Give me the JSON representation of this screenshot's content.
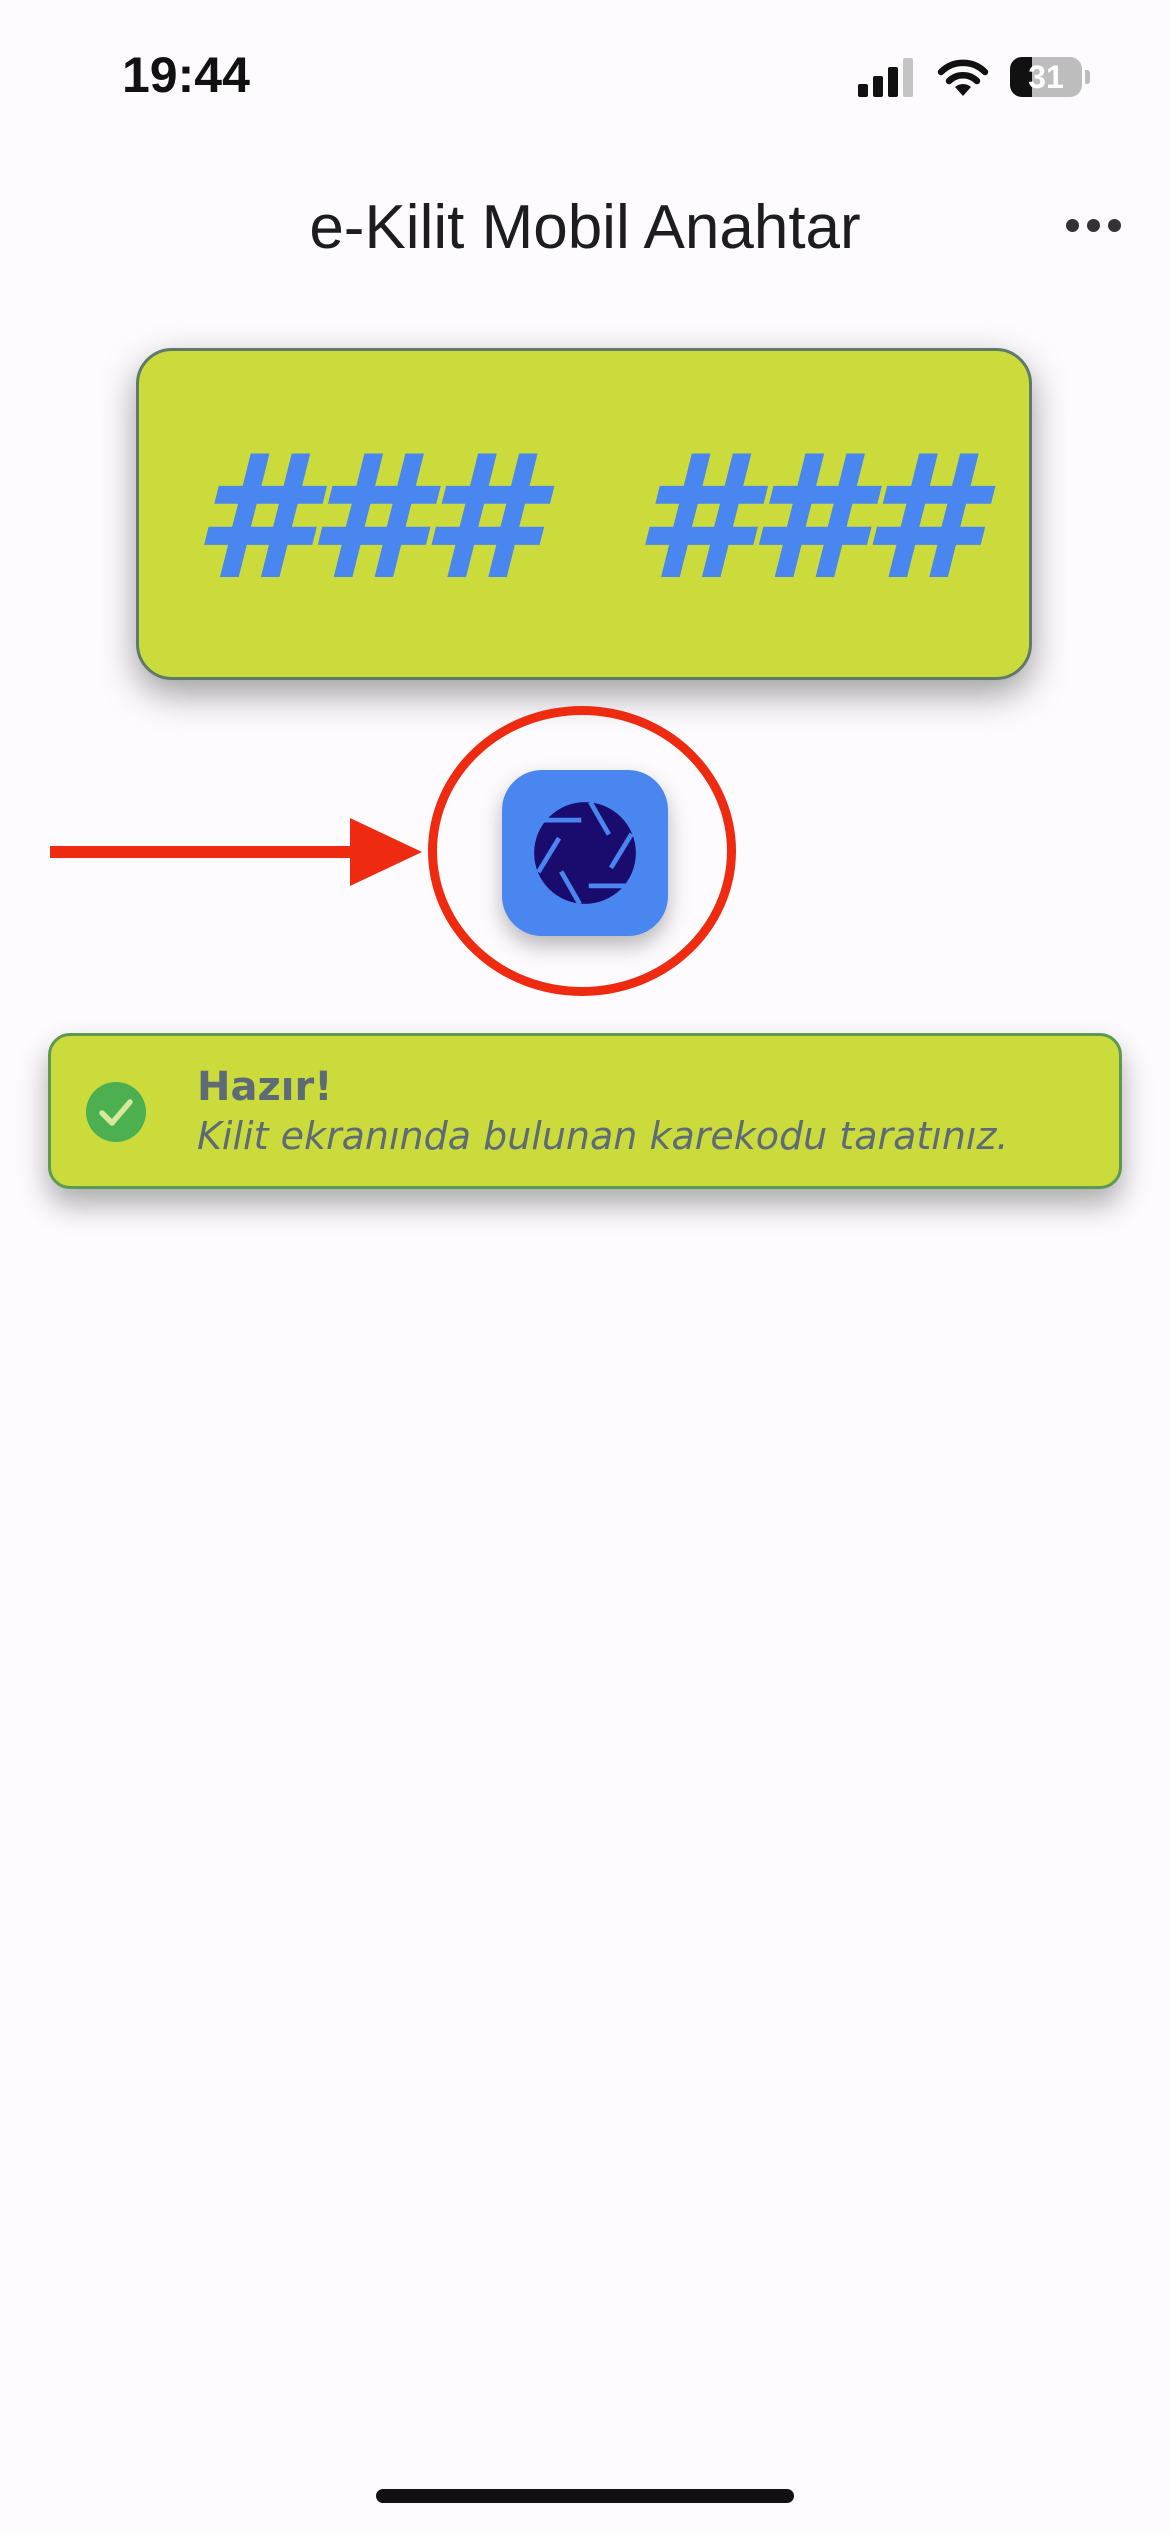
{
  "status_bar": {
    "time": "19:44",
    "battery_percent": "31",
    "icons": [
      "cellular-signal-icon",
      "wifi-icon",
      "battery-icon"
    ]
  },
  "header": {
    "title": "e-Kilit Mobil Anahtar",
    "more_icon": "ellipsis-icon"
  },
  "code_display": {
    "part1": "###",
    "part2": "###",
    "background_color": "#cbdb3c",
    "text_color": "#4a86f0"
  },
  "scan_button": {
    "icon": "camera-shutter-icon",
    "color": "#4a86f0"
  },
  "annotation": {
    "color": "#ee2a10",
    "shapes": [
      "arrow-icon",
      "circle-highlight"
    ]
  },
  "status_banner": {
    "title": "Hazır!",
    "message": "Kilit ekranında bulunan karekodu taratınız.",
    "icon": "check-circle-icon",
    "icon_color": "#4caf50",
    "background_color": "#cbdb3c"
  }
}
